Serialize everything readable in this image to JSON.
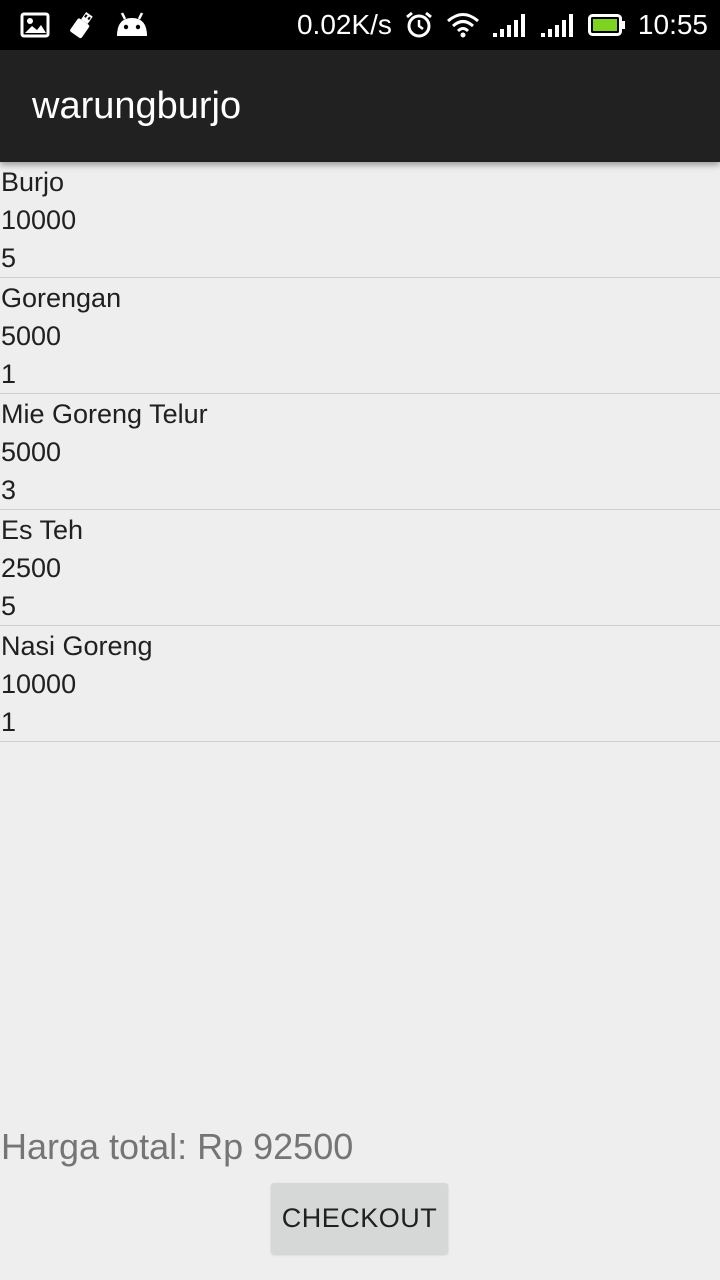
{
  "status_bar": {
    "network_speed": "0.02K/s",
    "time": "10:55",
    "icons": [
      "image-icon",
      "usb-debug-icon",
      "android-icon",
      "alarm-icon",
      "wifi-icon",
      "signal-icon",
      "signal-icon-2",
      "battery-icon"
    ],
    "battery_color": "#7ed321"
  },
  "action_bar": {
    "title": "warungburjo"
  },
  "items": [
    {
      "name": "Burjo",
      "price": "10000",
      "qty": "5"
    },
    {
      "name": "Gorengan",
      "price": "5000",
      "qty": "1"
    },
    {
      "name": "Mie Goreng Telur",
      "price": "5000",
      "qty": "3"
    },
    {
      "name": "Es Teh",
      "price": "2500",
      "qty": "5"
    },
    {
      "name": "Nasi Goreng",
      "price": "10000",
      "qty": "1"
    }
  ],
  "total": {
    "label": "Harga total: Rp 92500"
  },
  "checkout": {
    "label": "CHECKOUT"
  }
}
